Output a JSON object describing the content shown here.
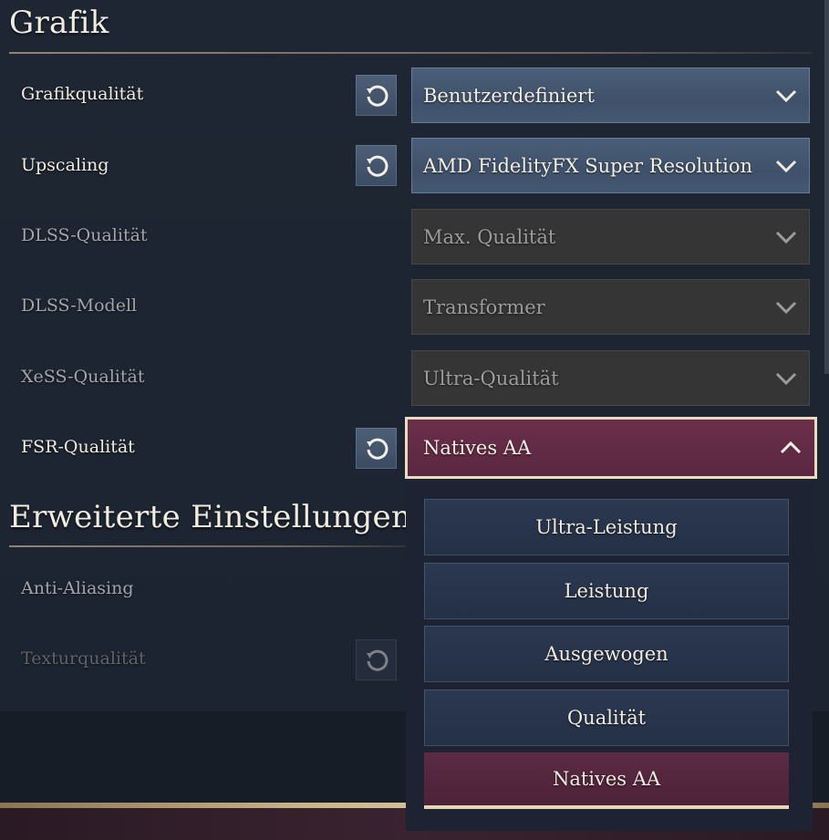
{
  "sections": {
    "grafik": "Grafik",
    "erweitert": "Erweiterte Einstellungen"
  },
  "rows": [
    {
      "label": "Grafikqualität",
      "value": "Benutzerdefiniert",
      "state": "active"
    },
    {
      "label": "Upscaling",
      "value": "AMD FidelityFX Super Resolution",
      "state": "active"
    },
    {
      "label": "DLSS-Qualität",
      "value": "Max. Qualität",
      "state": "disabled"
    },
    {
      "label": "DLSS-Modell",
      "value": "Transformer",
      "state": "disabled"
    },
    {
      "label": "XeSS-Qualität",
      "value": "Ultra-Qualität",
      "state": "disabled"
    },
    {
      "label": "FSR-Qualität",
      "value": "Natives AA",
      "state": "open"
    }
  ],
  "advanced_rows": [
    {
      "label": "Anti-Aliasing"
    },
    {
      "label": "Texturqualität"
    }
  ],
  "dropdown": {
    "options": [
      "Ultra-Leistung",
      "Leistung",
      "Ausgewogen",
      "Qualität",
      "Natives AA"
    ],
    "selected": "Natives AA"
  },
  "icons": {
    "reset": "reset-icon",
    "chevron_down": "chevron-down-icon",
    "chevron_up": "chevron-up-icon"
  },
  "colors": {
    "accent_open": "#6b2f4a",
    "active_select": "#4b5e79",
    "gold": "#cdb88e"
  }
}
